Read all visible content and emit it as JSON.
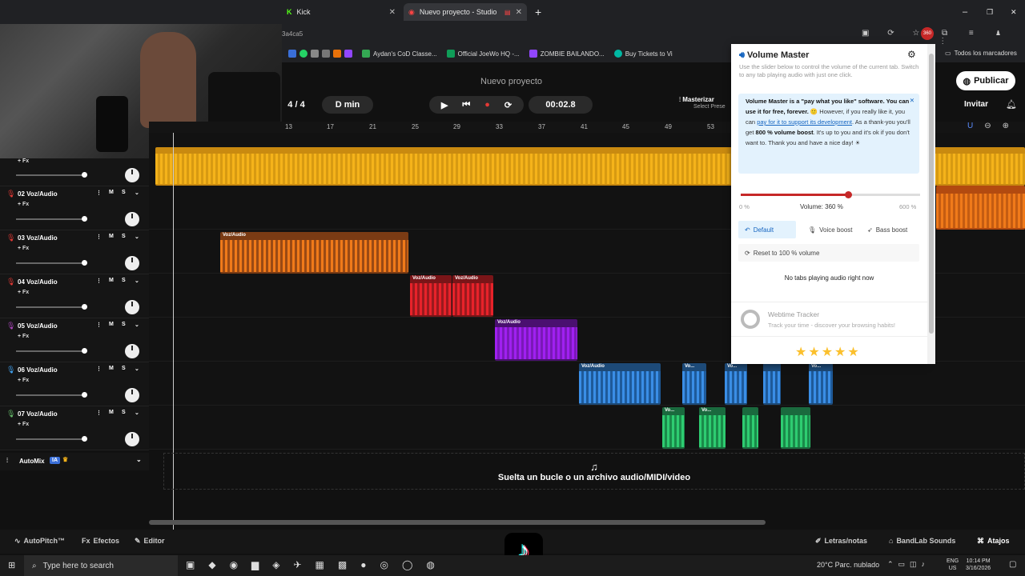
{
  "browser": {
    "tabs": [
      {
        "label": "Kick"
      },
      {
        "label": "Nuevo proyecto - Studio"
      }
    ],
    "url_fragment": "3a4ca5",
    "bookmarks": [
      "Aydan's CoD Classe...",
      "Official JoeWo HQ -...",
      "ZOMBIE BAILANDO...",
      "Buy Tickets to Vi"
    ],
    "bookmarks_folder": "Todos los marcadores"
  },
  "daw": {
    "project_title": "Nuevo proyecto",
    "time_signature": "4 / 4",
    "key": "D min",
    "time": "00:02.8",
    "masterize_label": "Masterizar",
    "masterize_sub": "Select Prese",
    "publish_label": "Publicar",
    "invite_label": "Invitar",
    "ruler_marks": [
      "13",
      "17",
      "21",
      "25",
      "29",
      "33",
      "37",
      "41",
      "45",
      "49",
      "53"
    ],
    "tracks": [
      {
        "name": "02 Voz/Audio",
        "fx": "+ Fx",
        "mic_color": "#e53935"
      },
      {
        "name": "03 Voz/Audio",
        "fx": "+ Fx",
        "mic_color": "#e53935"
      },
      {
        "name": "04 Voz/Audio",
        "fx": "+ Fx",
        "mic_color": "#e53935"
      },
      {
        "name": "05 Voz/Audio",
        "fx": "+ Fx",
        "mic_color": "#ab47bc"
      },
      {
        "name": "06 Voz/Audio",
        "fx": "+ Fx",
        "mic_color": "#42a5f5"
      },
      {
        "name": "07 Voz/Audio",
        "fx": "+ Fx",
        "mic_color": "#66bb6a"
      }
    ],
    "top_track_fx": "+ Fx",
    "mute_label": "M",
    "solo_label": "S",
    "clip_label": "Voz/Audio",
    "clip_label_short": "Vo...",
    "automix_label": "AutoMix",
    "automix_badge": "IA",
    "dropzone_text": "Suelta un bucle o un archivo audio/MIDI/video",
    "bottom": {
      "autopitch": "AutoPitch™",
      "effects": "Efectos",
      "editor": "Editor",
      "lyrics": "Letras/notas",
      "sounds": "BandLab Sounds",
      "shortcuts": "Atajos"
    },
    "colors": {
      "yellow": "#f5b31a",
      "orange": "#f07a1a",
      "red": "#e8222a",
      "purple": "#a020f0",
      "blue": "#3a8ee6",
      "green": "#2ecc71"
    }
  },
  "volume_master": {
    "title": "Volume Master",
    "description": "Use the slider below to control the volume of the current tab. Switch to any tab playing audio with just one click.",
    "note_b1": "Volume Master is a \"pay what you like\" software. You can use it for free, forever.",
    "note_t1": "However, if you really like it, you can",
    "note_link": "pay for it to support its development",
    "note_t2": ". As a thank-you you'll get",
    "note_b2": "800 % volume boost",
    "note_t3": ". It's up to you and it's ok if you don't want to. Thank you and have a nice day!",
    "slider_min": "0 %",
    "slider_max": "600 %",
    "volume_label": "Volume: 360 %",
    "volume_fraction": 0.6,
    "btn_default": "Default",
    "btn_voice": "Voice boost",
    "btn_bass": "Bass boost",
    "btn_reset": "Reset to 100 % volume",
    "no_tabs": "No tabs playing audio right now",
    "promo_title": "Webtime Tracker",
    "promo_desc": "Track your time - discover your browsing habits!",
    "stars": "★★★★★"
  },
  "taskbar": {
    "search_placeholder": "Type here to search",
    "weather": "20°C  Parc. nublado",
    "lang": "ENG",
    "region": "US",
    "time": "10:14 PM",
    "date": "3/16/2026"
  }
}
